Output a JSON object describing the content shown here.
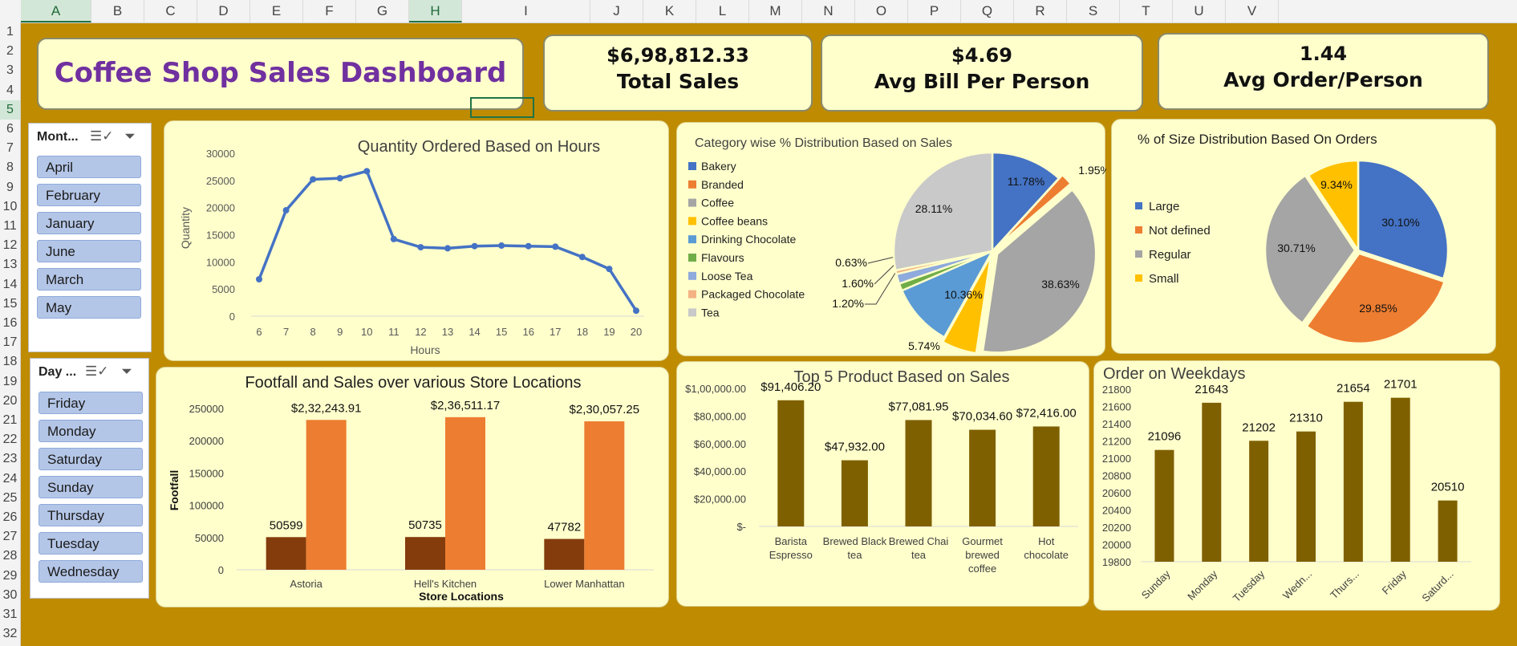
{
  "spreadsheet": {
    "columns": [
      "A",
      "B",
      "C",
      "D",
      "E",
      "F",
      "G",
      "H",
      "I",
      "J",
      "K",
      "L",
      "M",
      "N",
      "O",
      "P",
      "Q",
      "R",
      "S",
      "T",
      "U",
      "V"
    ],
    "rows": [
      "1",
      "2",
      "3",
      "4",
      "5",
      "6",
      "7",
      "8",
      "9",
      "10",
      "11",
      "12",
      "13",
      "14",
      "15",
      "16",
      "17",
      "18",
      "19",
      "20",
      "21",
      "22",
      "23",
      "24",
      "25",
      "26",
      "27",
      "28",
      "29",
      "30",
      "31",
      "32"
    ],
    "selected_column": "H",
    "selected_row": "5"
  },
  "dashboard": {
    "title": "Coffee Shop Sales Dashboard",
    "title_color": "#7030a0",
    "sheet_color": "#bf8b00",
    "panel_color": "#ffffcc"
  },
  "kpis": [
    {
      "value": "$6,98,812.33",
      "label": "Total Sales"
    },
    {
      "value": "$4.69",
      "label": "Avg Bill Per Person"
    },
    {
      "value": "1.44",
      "label": "Avg Order/Person"
    }
  ],
  "slicers": {
    "month": {
      "header": "Mont...",
      "items": [
        "April",
        "February",
        "January",
        "June",
        "March",
        "May"
      ],
      "multiselect_icon": "multiselect-icon",
      "clear_filter_icon": "clear-filter-icon"
    },
    "day": {
      "header": "Day ...",
      "items": [
        "Friday",
        "Monday",
        "Saturday",
        "Sunday",
        "Thursday",
        "Tuesday",
        "Wednesday"
      ],
      "multiselect_icon": "multiselect-icon",
      "clear_filter_icon": "clear-filter-icon"
    }
  },
  "chart_data": [
    {
      "id": "hours",
      "type": "line",
      "title": "Quantity Ordered Based on Hours",
      "xlabel": "Hours",
      "ylabel": "Quantity",
      "x": [
        6,
        7,
        8,
        9,
        10,
        11,
        12,
        13,
        14,
        15,
        16,
        17,
        18,
        19,
        20
      ],
      "values": [
        6800,
        19500,
        25200,
        25400,
        26700,
        14200,
        12700,
        12500,
        12900,
        13000,
        12900,
        12800,
        10900,
        8700,
        1000
      ],
      "ylim": [
        0,
        30000
      ],
      "yticks": [
        "0",
        "5000",
        "10000",
        "15000",
        "20000",
        "25000",
        "30000"
      ],
      "color": "#4472c4"
    },
    {
      "id": "category",
      "type": "pie",
      "title": "Category wise % Distribution Based on Sales",
      "legend_position": "left",
      "slices": [
        {
          "name": "Bakery",
          "value": 11.78,
          "label": "11.78%",
          "color": "#4472c4"
        },
        {
          "name": "Branded",
          "value": 1.95,
          "label": "1.95%",
          "color": "#ed7d31"
        },
        {
          "name": "Coffee",
          "value": 38.63,
          "label": "38.63%",
          "color": "#a5a5a5"
        },
        {
          "name": "Coffee beans",
          "value": 5.74,
          "label": "5.74%",
          "color": "#ffc000"
        },
        {
          "name": "Drinking Chocolate",
          "value": 10.36,
          "label": "10.36%",
          "color": "#5b9bd5"
        },
        {
          "name": "Flavours",
          "value": 1.2,
          "label": "1.20%",
          "color": "#70ad47"
        },
        {
          "name": "Loose Tea",
          "value": 1.6,
          "label": "1.60%",
          "color": "#8faadc"
        },
        {
          "name": "Packaged Chocolate",
          "value": 0.63,
          "label": "0.63%",
          "color": "#f4b183"
        },
        {
          "name": "Tea",
          "value": 28.11,
          "label": "28.11%",
          "color": "#c9c9c9"
        }
      ]
    },
    {
      "id": "size",
      "type": "pie",
      "title": "% of Size Distribution Based On Orders",
      "legend_position": "left",
      "slices": [
        {
          "name": "Large",
          "value": 30.1,
          "label": "30.10%",
          "color": "#4472c4"
        },
        {
          "name": "Not defined",
          "value": 29.85,
          "label": "29.85%",
          "color": "#ed7d31"
        },
        {
          "name": "Regular",
          "value": 30.71,
          "label": "30.71%",
          "color": "#a5a5a5"
        },
        {
          "name": "Small",
          "value": 9.34,
          "label": "9.34%",
          "color": "#ffc000"
        }
      ]
    },
    {
      "id": "stores",
      "type": "bar",
      "title": "Footfall and Sales over various Store Locations",
      "xlabel": "Store Locations",
      "ylabel": "Footfall",
      "categories": [
        "Astoria",
        "Hell's Kitchen",
        "Lower Manhattan"
      ],
      "series": [
        {
          "values": [
            50599,
            50735,
            47782
          ],
          "labels": [
            "50599",
            "50735",
            "47782"
          ],
          "color": "#843c0c"
        },
        {
          "values": [
            232243.91,
            236511.17,
            230057.25
          ],
          "labels": [
            "$2,32,243.91",
            "$2,36,511.17",
            "$2,30,057.25"
          ],
          "color": "#ed7d31"
        }
      ],
      "ylim": [
        0,
        250000
      ],
      "yticks": [
        "0",
        "50000",
        "100000",
        "150000",
        "200000",
        "250000"
      ]
    },
    {
      "id": "products",
      "type": "bar",
      "title": "Top 5 Product Based on Sales",
      "categories": [
        "Barista Espresso",
        "Brewed Black tea",
        "Brewed Chai tea",
        "Gourmet brewed coffee",
        "Hot chocolate"
      ],
      "category_lines": [
        [
          "Barista",
          "Espresso"
        ],
        [
          "Brewed Black",
          "tea"
        ],
        [
          "Brewed Chai",
          "tea"
        ],
        [
          "Gourmet",
          "brewed",
          "coffee"
        ],
        [
          "Hot",
          "chocolate"
        ]
      ],
      "values": [
        91406.2,
        47932.0,
        77081.95,
        70034.6,
        72416.0
      ],
      "labels": [
        "$91,406.20",
        "$47,932.00",
        "$77,081.95",
        "$70,034.60",
        "$72,416.00"
      ],
      "ylim": [
        0,
        100000
      ],
      "yticks": [
        "$-",
        "$20,000.00",
        "$40,000.00",
        "$60,000.00",
        "$80,000.00",
        "$1,00,000.00"
      ],
      "color": "#7f6000"
    },
    {
      "id": "weekdays",
      "type": "bar",
      "title": "Order on Weekdays",
      "categories": [
        "Sunday",
        "Monday",
        "Tuesday",
        "Wedn...",
        "Thurs...",
        "Friday",
        "Saturd..."
      ],
      "values": [
        21096,
        21643,
        21202,
        21310,
        21654,
        21701,
        20510
      ],
      "labels": [
        "21096",
        "21643",
        "21202",
        "21310",
        "21654",
        "21701",
        "20510"
      ],
      "ylim": [
        19800,
        21800
      ],
      "yticks": [
        "19800",
        "20000",
        "20200",
        "20400",
        "20600",
        "20800",
        "21000",
        "21200",
        "21400",
        "21600",
        "21800"
      ],
      "color": "#7f6000"
    }
  ]
}
